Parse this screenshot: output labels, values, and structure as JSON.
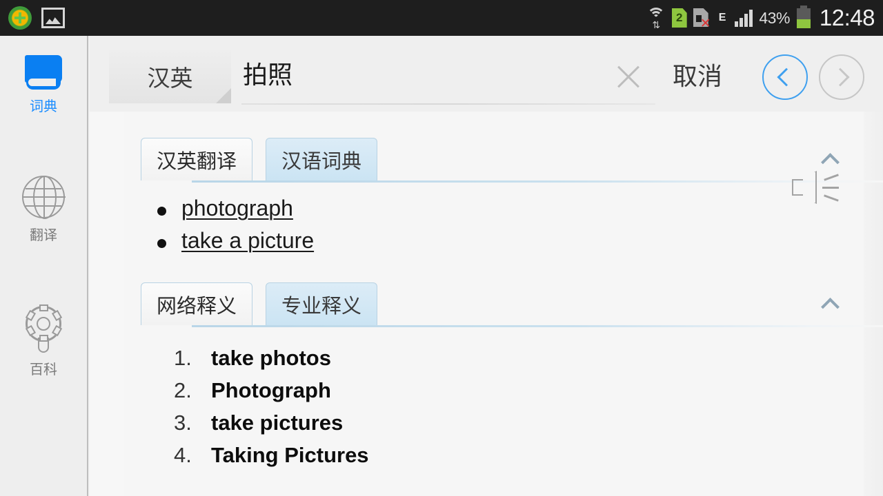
{
  "statusbar": {
    "left_icons": [
      {
        "name": "appstore-icon"
      },
      {
        "name": "gallery-icon"
      }
    ],
    "wifi_icon": "wifi-signal-icon",
    "sim2_label": "2",
    "nosim_icon": "no-sim-card-icon",
    "network_type": "E",
    "signal_icon": "cellular-signal-icon",
    "battery_percent": "43%",
    "battery_icon": "battery-icon",
    "clock": "12:48"
  },
  "sidebar": {
    "items": [
      {
        "label": "词典",
        "icon": "book-icon",
        "active": true
      },
      {
        "label": "翻译",
        "icon": "globe-icon",
        "active": false
      },
      {
        "label": "百科",
        "icon": "gear-icon",
        "active": false
      }
    ]
  },
  "topbar": {
    "language_selector": "汉英",
    "search_value": "拍照",
    "search_placeholder": "",
    "clear_icon": "close-icon",
    "cancel_label": "取消",
    "back_icon": "chevron-left-icon",
    "forward_icon": "chevron-right-icon"
  },
  "sections": [
    {
      "tabs": [
        {
          "label": "汉英翻译",
          "active": true
        },
        {
          "label": "汉语词典",
          "active": false
        }
      ],
      "collapse_icon": "chevron-up-icon",
      "speaker_icon": "speaker-icon",
      "entries": [
        "photograph",
        "take a picture"
      ]
    },
    {
      "tabs": [
        {
          "label": "网络释义",
          "active": true
        },
        {
          "label": "专业释义",
          "active": false
        }
      ],
      "collapse_icon": "chevron-up-icon",
      "entries": [
        "take photos",
        "Photograph",
        "take pictures",
        "Taking Pictures"
      ]
    }
  ],
  "colors": {
    "accent_blue": "#0a7ff2",
    "nav_blue": "#3fa0ef",
    "tab_border": "#b8d2e3",
    "tab_inactive_bg": "#cbe4f3",
    "statusbar_bg": "#1e1e1e",
    "battery_green": "#8ec63f"
  }
}
